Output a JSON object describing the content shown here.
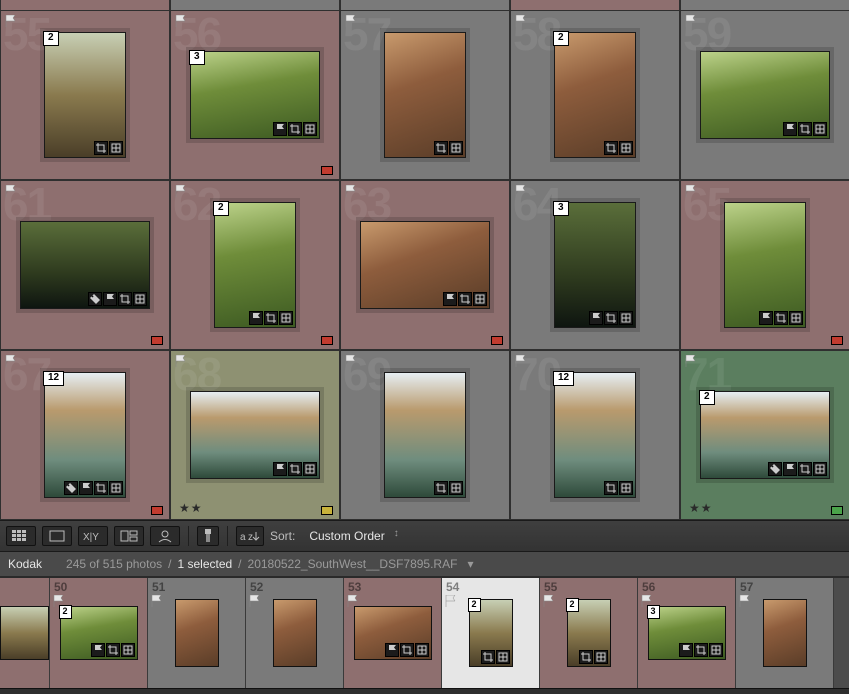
{
  "grid": {
    "cells": [
      {
        "idx": "55",
        "bg": "rose",
        "shape": "tall",
        "stack": "2",
        "inner": "path",
        "flag": true,
        "icons": 2,
        "color": null,
        "stars": 0
      },
      {
        "idx": "56",
        "bg": "rose",
        "shape": "wide",
        "stack": "3",
        "inner": "green",
        "flag": true,
        "icons": 3,
        "color": "red",
        "stars": 0
      },
      {
        "idx": "57",
        "bg": "gray",
        "shape": "tall",
        "stack": null,
        "inner": "canyon",
        "flag": true,
        "icons": 2,
        "color": null,
        "stars": 0
      },
      {
        "idx": "58",
        "bg": "gray",
        "shape": "tall",
        "stack": "2",
        "inner": "canyon",
        "flag": true,
        "icons": 2,
        "color": null,
        "stars": 0
      },
      {
        "idx": "59",
        "bg": "gray",
        "shape": "wide",
        "stack": null,
        "inner": "green",
        "flag": true,
        "icons": 3,
        "color": null,
        "stars": 0
      },
      {
        "idx": "61",
        "bg": "rose",
        "shape": "wide",
        "stack": null,
        "inner": "dark",
        "flag": true,
        "icons": 4,
        "color": "red",
        "stars": 0
      },
      {
        "idx": "62",
        "bg": "rose",
        "shape": "tall",
        "stack": "2",
        "inner": "green",
        "flag": true,
        "icons": 3,
        "color": "red",
        "stars": 0
      },
      {
        "idx": "63",
        "bg": "rose",
        "shape": "wide",
        "stack": null,
        "inner": "canyon",
        "flag": true,
        "icons": 3,
        "color": "red",
        "stars": 0
      },
      {
        "idx": "64",
        "bg": "gray",
        "shape": "tall",
        "stack": "3",
        "inner": "dark",
        "flag": true,
        "icons": 3,
        "color": null,
        "stars": 0
      },
      {
        "idx": "65",
        "bg": "rose",
        "shape": "tall",
        "stack": null,
        "inner": "green",
        "flag": true,
        "icons": 3,
        "color": "red",
        "stars": 0
      },
      {
        "idx": "67",
        "bg": "rose",
        "shape": "tall",
        "stack": "12",
        "inner": "falls",
        "flag": true,
        "icons": 4,
        "color": "red",
        "stars": 0
      },
      {
        "idx": "68",
        "bg": "olive",
        "shape": "wide",
        "stack": null,
        "inner": "falls",
        "flag": true,
        "icons": 3,
        "color": "yellow",
        "stars": 2
      },
      {
        "idx": "69",
        "bg": "gray",
        "shape": "tall",
        "stack": null,
        "inner": "falls",
        "flag": true,
        "icons": 2,
        "color": null,
        "stars": 0
      },
      {
        "idx": "70",
        "bg": "gray",
        "shape": "tall",
        "stack": "12",
        "inner": "falls",
        "flag": true,
        "icons": 2,
        "color": null,
        "stars": 0
      },
      {
        "idx": "71",
        "bg": "green",
        "shape": "wide",
        "stack": "2",
        "inner": "falls",
        "flag": true,
        "icons": 4,
        "color": "green",
        "stars": 2
      }
    ]
  },
  "toolbar": {
    "sort_label": "Sort:",
    "sort_value": "Custom Order"
  },
  "status": {
    "folder": "Kodak",
    "count": "245 of 515 photos",
    "sep": "/",
    "selected": "1 selected",
    "filename": "20180522_SouthWest__DSF7895.RAF"
  },
  "filmstrip": {
    "cells": [
      {
        "idx": "",
        "first": true,
        "bg": "rose",
        "shape": "wide",
        "stack": null,
        "inner": "path",
        "icons": 0,
        "selected": false
      },
      {
        "idx": "50",
        "bg": "rose",
        "shape": "wide",
        "stack": "2",
        "inner": "green",
        "icons": 3,
        "selected": false
      },
      {
        "idx": "51",
        "bg": "gray",
        "shape": "tall",
        "stack": null,
        "inner": "canyon",
        "icons": 0,
        "selected": false
      },
      {
        "idx": "52",
        "bg": "gray",
        "shape": "tall",
        "stack": null,
        "inner": "canyon",
        "icons": 0,
        "selected": false
      },
      {
        "idx": "53",
        "bg": "rose",
        "shape": "wide",
        "stack": null,
        "inner": "canyon",
        "icons": 3,
        "selected": false
      },
      {
        "idx": "54",
        "bg": "sel",
        "shape": "tall",
        "stack": "2",
        "inner": "path",
        "icons": 2,
        "selected": true
      },
      {
        "idx": "55",
        "bg": "rose",
        "shape": "tall",
        "stack": "2",
        "inner": "path",
        "icons": 2,
        "selected": false
      },
      {
        "idx": "56",
        "bg": "rose",
        "shape": "wide",
        "stack": "3",
        "inner": "green",
        "icons": 3,
        "selected": false
      },
      {
        "idx": "57",
        "bg": "gray",
        "shape": "tall",
        "stack": null,
        "inner": "canyon",
        "icons": 0,
        "selected": false
      }
    ]
  }
}
